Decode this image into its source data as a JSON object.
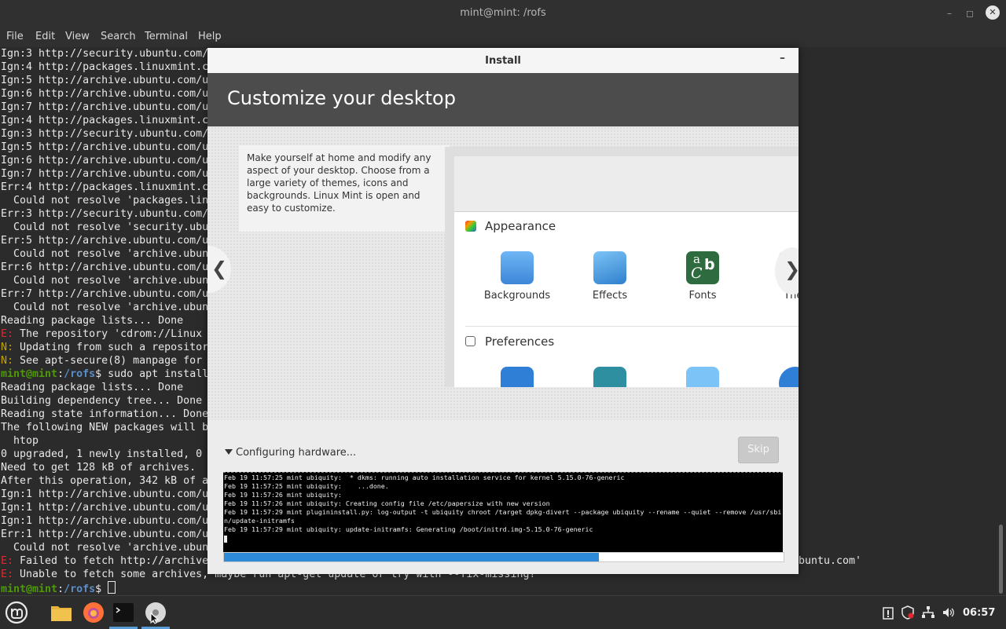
{
  "window": {
    "title": "mint@mint: /rofs",
    "min_glyph": "–",
    "max_glyph": "◻",
    "close_glyph": "✕"
  },
  "menu": [
    "File",
    "Edit",
    "View",
    "Search",
    "Terminal",
    "Help"
  ],
  "terminal": {
    "lines": [
      "Ign:3 http://security.ubuntu.com/",
      "Ign:4 http://packages.linuxmint.c",
      "Ign:5 http://archive.ubuntu.com/u",
      "Ign:6 http://archive.ubuntu.com/u",
      "Ign:7 http://archive.ubuntu.com/u",
      "Ign:4 http://packages.linuxmint.c",
      "Ign:3 http://security.ubuntu.com/",
      "Ign:5 http://archive.ubuntu.com/u",
      "Ign:6 http://archive.ubuntu.com/u",
      "Ign:7 http://archive.ubuntu.com/u",
      "Err:4 http://packages.linuxmint.c",
      "  Could not resolve 'packages.lin",
      "Err:3 http://security.ubuntu.com/",
      "  Could not resolve 'security.ubu",
      "Err:5 http://archive.ubuntu.com/u",
      "  Could not resolve 'archive.ubun",
      "Err:6 http://archive.ubuntu.com/u",
      "  Could not resolve 'archive.ubun",
      "Err:7 http://archive.ubuntu.com/u",
      "  Could not resolve 'archive.ubun",
      "Reading package lists... Done"
    ],
    "e_repo": " The repository 'cdrom://Linux",
    "n_updating": " Updating from such a repositor",
    "n_see": " See apt-secure(8) manpage for",
    "prompt_user": "mint@mint",
    "prompt_path": "/rofs",
    "cmd": "$ sudo apt install",
    "lines2": [
      "Reading package lists... Done",
      "Building dependency tree... Done",
      "Reading state information... Done",
      "The following NEW packages will b",
      "  htop",
      "0 upgraded, 1 newly installed, 0",
      "Need to get 128 kB of archives.",
      "After this operation, 342 kB of a",
      "Ign:1 http://archive.ubuntu.com/u",
      "Ign:1 http://archive.ubuntu.com/u",
      "Ign:1 http://archive.ubuntu.com/u",
      "Err:1 http://archive.ubuntu.com/u",
      "  Could not resolve 'archive.ubun"
    ],
    "e_failed": " Failed to fetch http://archive",
    "e_failed_tail": "buntu.com'",
    "e_unable": " Unable to fetch some archives, maybe run apt-get update or try with --fix-missing?",
    "prompt_end": "$ ",
    "e_tag": "E:",
    "n_tag": "N:"
  },
  "installer": {
    "title": "Install",
    "heading": "Customize your desktop",
    "description": "Make yourself at home and modify any aspect of your desktop. Choose from a large variety of themes, icons and backgrounds. Linux Mint is open and easy to customize.",
    "prev_glyph": "❮",
    "next_glyph": "❯",
    "section_appearance": "Appearance",
    "section_preferences": "Preferences",
    "apps": [
      {
        "label": "Backgrounds",
        "icon": "backgrounds-icon",
        "color": "#4a9be8"
      },
      {
        "label": "Effects",
        "icon": "effects-icon",
        "color": "#3b8fd6"
      },
      {
        "label": "Fonts",
        "icon": "fonts-icon",
        "color": "#2e6b3e"
      },
      {
        "label": "Ther",
        "icon": "themes-icon",
        "color": "#d0d0d0"
      }
    ],
    "fonts_glyph_a": "a",
    "fonts_glyph_b": "b",
    "fonts_glyph_c": "C",
    "status": "Configuring hardware...",
    "skip": "Skip",
    "log": [
      "Feb 19 11:57:25 mint ubiquity:  * dkms: running auto installation service for kernel 5.15.0-76-generic",
      "Feb 19 11:57:25 mint ubiquity:    ...done.",
      "Feb 19 11:57:26 mint ubiquity:",
      "Feb 19 11:57:26 mint ubiquity: Creating config file /etc/papersize with new version",
      "Feb 19 11:57:29 mint plugininstall.py: log-output -t ubiquity chroot /target dpkg-divert --package ubiquity --rename --quiet --remove /usr/sbi",
      "n/update-initramfs",
      "Feb 19 11:57:29 mint ubiquity: update-initramfs: Generating /boot/initrd.img-5.15.0-76-generic"
    ],
    "progress": 0.67
  },
  "taskbar": {
    "clock": "06:57"
  },
  "colors": {
    "accent": "#2d8ad8",
    "mint_green": "#4e9a06",
    "error_red": "#e0282e"
  }
}
